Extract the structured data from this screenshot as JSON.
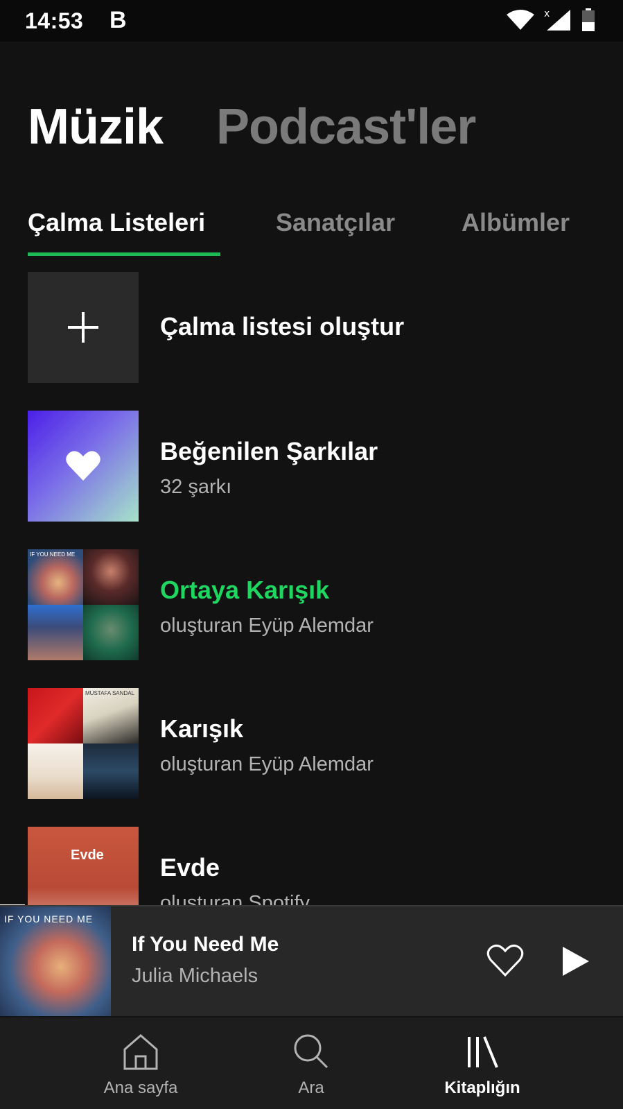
{
  "status": {
    "time": "14:53",
    "notification": "B"
  },
  "categories": {
    "music": "Müzik",
    "podcasts": "Podcast'ler"
  },
  "subtabs": {
    "playlists": "Çalma Listeleri",
    "artists": "Sanatçılar",
    "albums": "Albümler"
  },
  "list": {
    "create": {
      "title": "Çalma listesi oluştur"
    },
    "liked": {
      "title": "Beğenilen Şarkılar",
      "subtitle": "32 şarkı"
    },
    "ortaya": {
      "title": "Ortaya Karışık",
      "subtitle": "oluşturan Eyüp Alemdar"
    },
    "karisik": {
      "title": "Karışık",
      "subtitle": "oluşturan Eyüp Alemdar"
    },
    "evde": {
      "title": "Evde",
      "subtitle": "oluşturan Spotify",
      "art_text": "Evde"
    }
  },
  "mosaic_text": {
    "ortaya_tl": "IF YOU NEED ME",
    "karisik_tr": "MUSTAFA SANDAL"
  },
  "now_playing": {
    "title": "If You Need Me",
    "artist": "Julia Michaels",
    "art_text": "IF YOU NEED ME",
    "progress": 0.04
  },
  "nav": {
    "home": "Ana sayfa",
    "search": "Ara",
    "library": "Kitaplığın"
  },
  "colors": {
    "accent": "#1db954",
    "background": "#121212"
  }
}
